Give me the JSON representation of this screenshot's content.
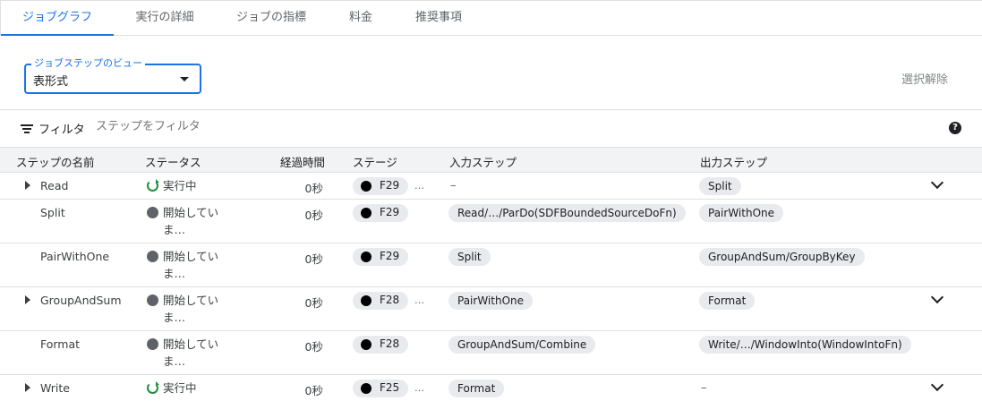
{
  "tabs": [
    {
      "label": "ジョブグラフ",
      "active": true
    },
    {
      "label": "実行の詳細",
      "active": false
    },
    {
      "label": "ジョブの指標",
      "active": false
    },
    {
      "label": "料金",
      "active": false
    },
    {
      "label": "推奨事項",
      "active": false
    }
  ],
  "view_select": {
    "label": "ジョブステップのビュー",
    "value": "表形式"
  },
  "clear_selection": "選択解除",
  "filter": {
    "label": "フィルタ",
    "placeholder": "ステップをフィルタ"
  },
  "help_icon": "?",
  "columns": [
    "ステップの名前",
    "ステータス",
    "経過時間",
    "ステージ",
    "入力ステップ",
    "出力ステップ"
  ],
  "rows": [
    {
      "name": "Read",
      "expandable": true,
      "status": "実行中",
      "status_type": "running",
      "elapsed": "0秒",
      "stage": "F29",
      "stage_more": "…",
      "inputs": "–",
      "outputs": "Split",
      "has_chevron": true
    },
    {
      "name": "Split",
      "expandable": false,
      "status": "開始していま…",
      "status_type": "pending",
      "elapsed": "0秒",
      "stage": "F29",
      "stage_more": "",
      "inputs": "Read/…/ParDo(SDFBoundedSourceDoFn)",
      "outputs": "PairWithOne",
      "has_chevron": false
    },
    {
      "name": "PairWithOne",
      "expandable": false,
      "status": "開始していま…",
      "status_type": "pending",
      "elapsed": "0秒",
      "stage": "F29",
      "stage_more": "",
      "inputs": "Split",
      "outputs": "GroupAndSum/GroupByKey",
      "has_chevron": false
    },
    {
      "name": "GroupAndSum",
      "expandable": true,
      "status": "開始していま…",
      "status_type": "pending",
      "elapsed": "0秒",
      "stage": "F28",
      "stage_more": "…",
      "inputs": "PairWithOne",
      "outputs": "Format",
      "has_chevron": true
    },
    {
      "name": "Format",
      "expandable": false,
      "status": "開始していま…",
      "status_type": "pending",
      "elapsed": "0秒",
      "stage": "F28",
      "stage_more": "",
      "inputs": "GroupAndSum/Combine",
      "outputs": "Write/…/WindowInto(WindowIntoFn)",
      "has_chevron": false
    },
    {
      "name": "Write",
      "expandable": true,
      "status": "実行中",
      "status_type": "running",
      "elapsed": "0秒",
      "stage": "F25",
      "stage_more": "…",
      "inputs": "Format",
      "outputs": "–",
      "has_chevron": true
    }
  ],
  "colors": {
    "accent": "#1a73e8",
    "running": "#1e8e3e",
    "pending": "#5f6368",
    "chip_bg": "#e8eaed"
  }
}
